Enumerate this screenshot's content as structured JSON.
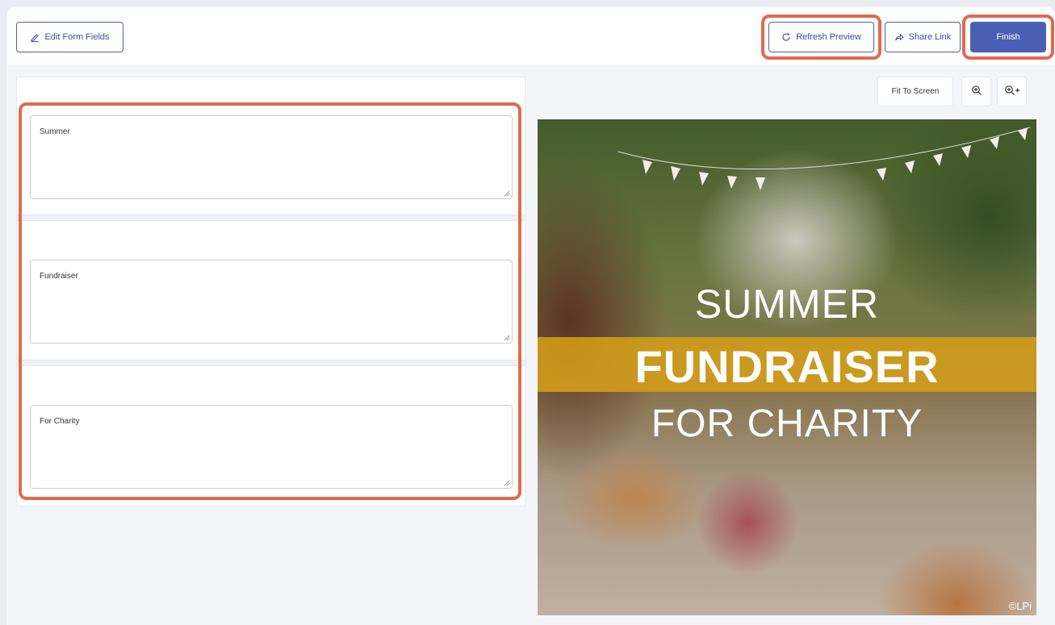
{
  "toolbar": {
    "edit_form_fields": "Edit Form Fields",
    "refresh_preview": "Refresh Preview",
    "share_link": "Share Link",
    "finish": "Finish"
  },
  "form": {
    "fields": [
      {
        "value": "Summer"
      },
      {
        "value": "Fundraiser"
      },
      {
        "value": "For Charity"
      }
    ]
  },
  "preview_tools": {
    "fit_to_screen": "Fit To Screen"
  },
  "preview": {
    "line1": "SUMMER",
    "line2": "FUNDRAISER",
    "line3": "FOR CHARITY",
    "copyright": "©LPi"
  },
  "colors": {
    "primary": "#4a5fb3",
    "highlight": "#e06a4e",
    "band": "#d6a018"
  },
  "icons": {
    "edit": "pencil-icon",
    "refresh": "refresh-icon",
    "share": "share-icon",
    "zoom_in": "zoom-in-icon",
    "zoom_plus": "zoom-in-plus-icon"
  }
}
